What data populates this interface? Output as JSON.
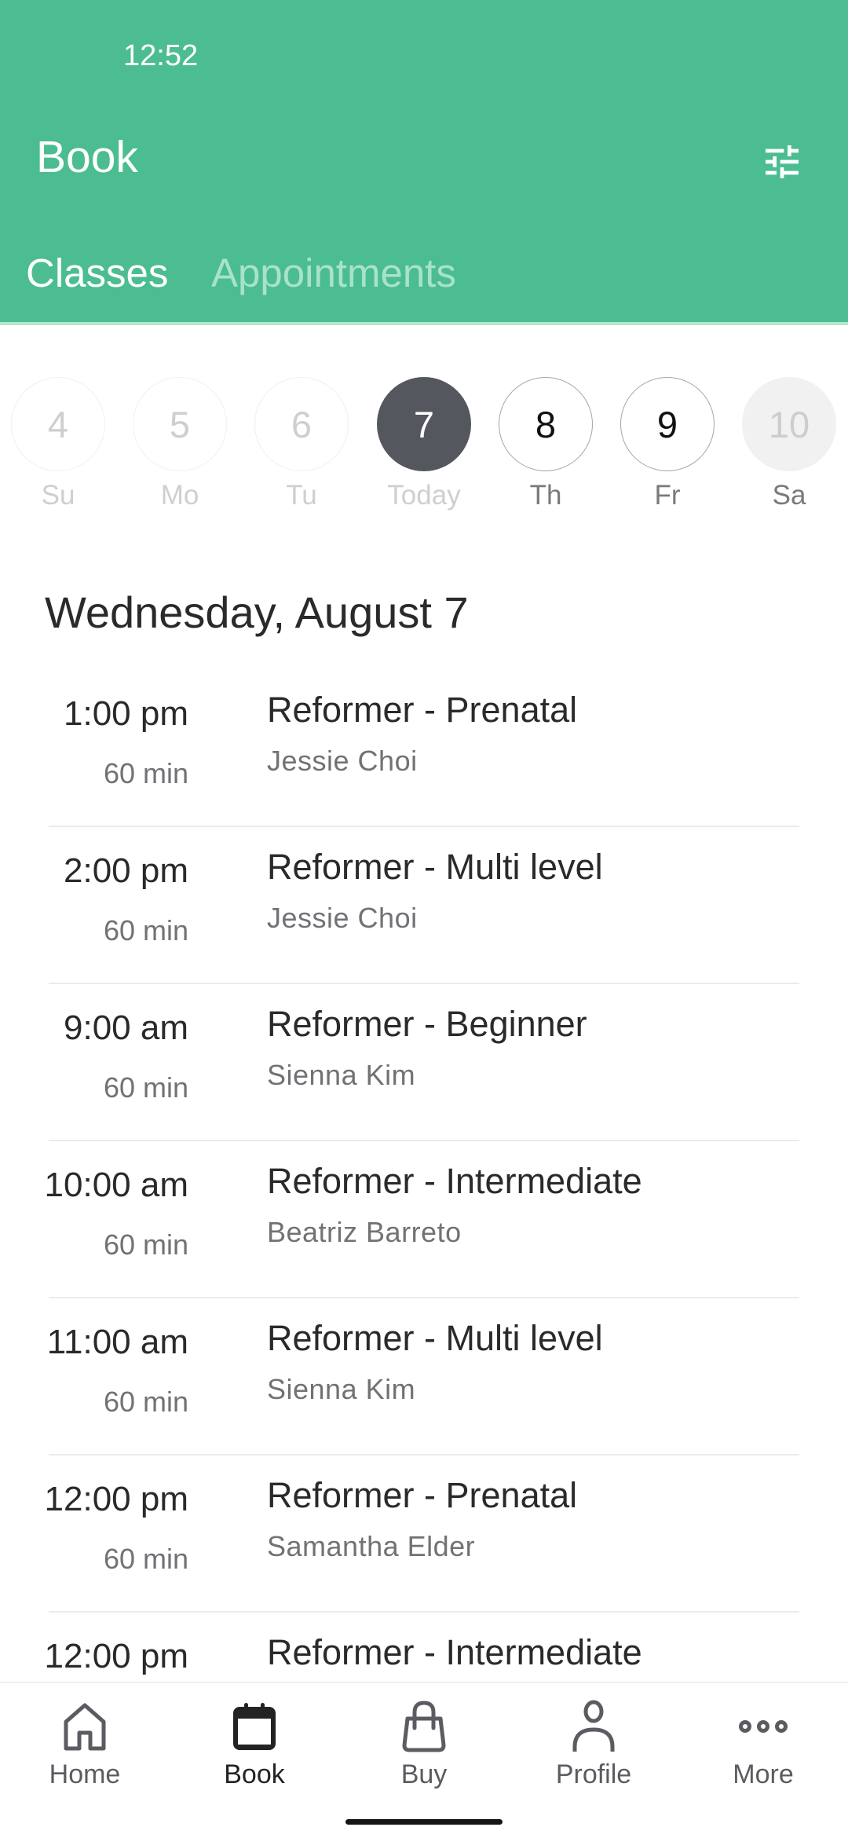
{
  "status_bar": {
    "time": "12:52"
  },
  "header": {
    "title": "Book",
    "filter_icon": "tune-icon",
    "tabs": [
      {
        "label": "Classes",
        "active": true
      },
      {
        "label": "Appointments",
        "active": false
      }
    ],
    "color": "#4bbd91"
  },
  "date_strip": [
    {
      "day": "4",
      "label": "Su",
      "state": "past"
    },
    {
      "day": "5",
      "label": "Mo",
      "state": "past"
    },
    {
      "day": "6",
      "label": "Tu",
      "state": "past"
    },
    {
      "day": "7",
      "label": "Today",
      "state": "selected"
    },
    {
      "day": "8",
      "label": "Th",
      "state": "future"
    },
    {
      "day": "9",
      "label": "Fr",
      "state": "future"
    },
    {
      "day": "10",
      "label": "Sa",
      "state": "disabled"
    }
  ],
  "schedule": {
    "date_heading": "Wednesday, August 7",
    "classes": [
      {
        "time": "1:00 pm",
        "duration": "60 min",
        "name": "Reformer - Prenatal",
        "instructor": "Jessie Choi"
      },
      {
        "time": "2:00 pm",
        "duration": "60 min",
        "name": "Reformer - Multi level",
        "instructor": "Jessie Choi"
      },
      {
        "time": "9:00 am",
        "duration": "60 min",
        "name": "Reformer - Beginner",
        "instructor": "Sienna Kim"
      },
      {
        "time": "10:00 am",
        "duration": "60 min",
        "name": "Reformer - Intermediate",
        "instructor": "Beatriz Barreto"
      },
      {
        "time": "11:00 am",
        "duration": "60 min",
        "name": "Reformer - Multi level",
        "instructor": "Sienna Kim"
      },
      {
        "time": "12:00 pm",
        "duration": "60 min",
        "name": "Reformer - Prenatal",
        "instructor": "Samantha Elder"
      },
      {
        "time": "12:00 pm",
        "duration": "",
        "name": "Reformer - Intermediate",
        "instructor": ""
      }
    ]
  },
  "bottom_nav": [
    {
      "label": "Home",
      "icon": "home-icon",
      "active": false
    },
    {
      "label": "Book",
      "icon": "calendar-icon",
      "active": true
    },
    {
      "label": "Buy",
      "icon": "shopping-bag-icon",
      "active": false
    },
    {
      "label": "Profile",
      "icon": "person-icon",
      "active": false
    },
    {
      "label": "More",
      "icon": "more-horizontal-icon",
      "active": false
    }
  ]
}
